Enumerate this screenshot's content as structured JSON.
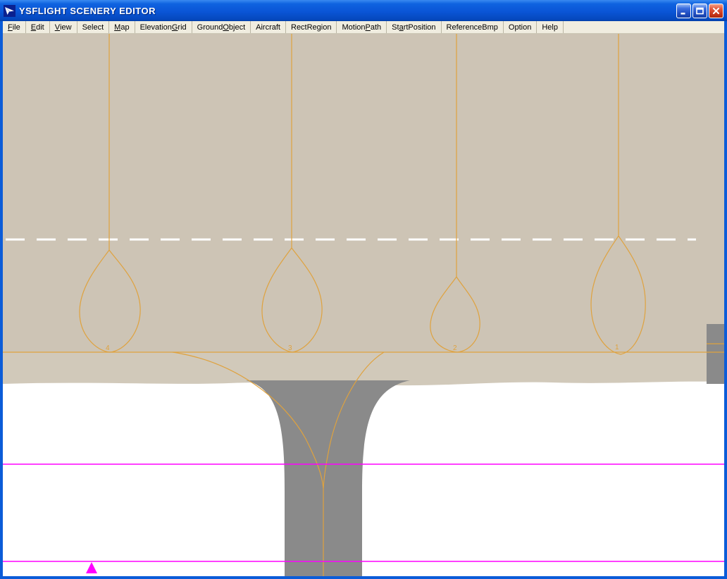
{
  "window": {
    "title": "YSFLIGHT SCENERY EDITOR",
    "controls": [
      {
        "name": "minimize-icon"
      },
      {
        "name": "maximize-icon"
      },
      {
        "name": "close-icon"
      }
    ]
  },
  "menu": {
    "items": [
      {
        "pre": "",
        "key": "F",
        "post": "ile"
      },
      {
        "pre": "",
        "key": "E",
        "post": "dit"
      },
      {
        "pre": "",
        "key": "V",
        "post": "iew"
      },
      {
        "pre": "Select",
        "key": "",
        "post": ""
      },
      {
        "pre": "",
        "key": "M",
        "post": "ap"
      },
      {
        "pre": "Elevation",
        "key": "G",
        "post": "rid"
      },
      {
        "pre": "Ground",
        "key": "O",
        "post": "bject"
      },
      {
        "pre": "Aircraft",
        "key": "",
        "post": ""
      },
      {
        "pre": "RectRegion",
        "key": "",
        "post": ""
      },
      {
        "pre": "Motion",
        "key": "P",
        "post": "ath"
      },
      {
        "pre": "St",
        "key": "a",
        "post": "rtPosition"
      },
      {
        "pre": "ReferenceBmp",
        "key": "",
        "post": ""
      },
      {
        "pre": "Option",
        "key": "",
        "post": ""
      },
      {
        "pre": "Help",
        "key": "",
        "post": ""
      }
    ]
  },
  "canvas": {
    "motion_paths": [
      {
        "label": "4"
      },
      {
        "label": "3"
      },
      {
        "label": "2"
      },
      {
        "label": "1"
      }
    ]
  },
  "colors": {
    "ground_tan": "#cdc4b5",
    "apron_tan": "#d1c9ba",
    "taxiway_gray": "#8a8a8a",
    "path_orange": "#dfa23e",
    "marker_magenta": "#ff00ff",
    "titlebar_blue": "#0b5cd8",
    "menubar_beige": "#f0ede0"
  }
}
